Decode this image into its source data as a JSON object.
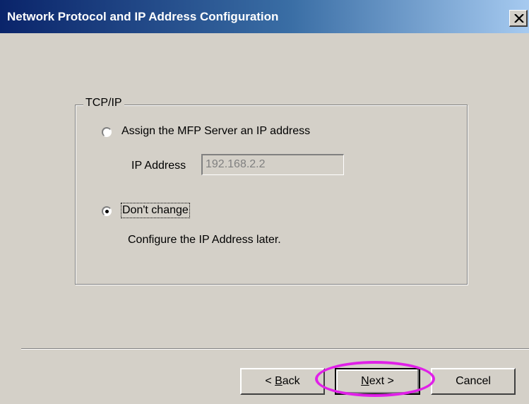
{
  "window": {
    "title": "Network Protocol and IP Address Configuration"
  },
  "group": {
    "legend": "TCP/IP",
    "options": [
      {
        "label": "Assign the MFP Server an IP address",
        "selected": false
      },
      {
        "label": "Don't change",
        "selected": true
      }
    ],
    "ip_label": "IP Address",
    "ip_value": "192.168.2.2",
    "note": "Configure the IP Address later."
  },
  "buttons": {
    "back_prefix": "< ",
    "back_mnemonic": "B",
    "back_rest": "ack",
    "next_mnemonic": "N",
    "next_rest": "ext >",
    "cancel": "Cancel"
  },
  "colors": {
    "highlight": "#e020e8",
    "titlebar": "#0a246a"
  },
  "icons": {
    "close": "close-icon"
  }
}
